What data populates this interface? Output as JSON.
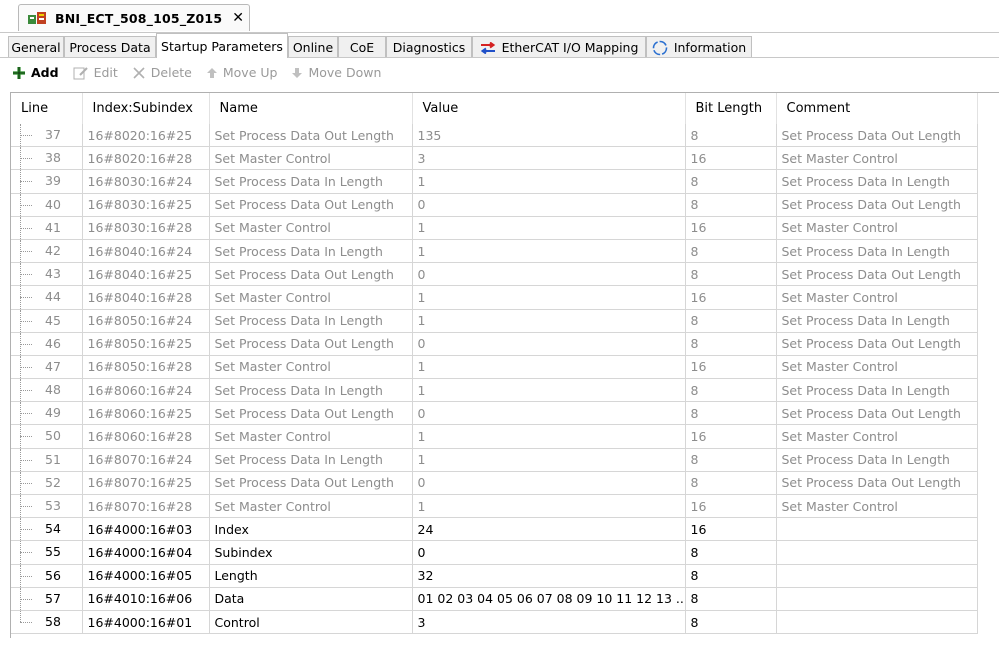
{
  "document": {
    "title": "BNI_ECT_508_105_Z015",
    "close_glyph": "✕"
  },
  "tabs": [
    {
      "label": "General",
      "active": false
    },
    {
      "label": "Process Data",
      "active": false
    },
    {
      "label": "Startup Parameters",
      "active": true
    },
    {
      "label": "Online",
      "active": false
    },
    {
      "label": "CoE",
      "active": false
    },
    {
      "label": "Diagnostics",
      "active": false
    },
    {
      "label": "EtherCAT I/O Mapping",
      "active": false,
      "icon": "io-mapping-icon"
    },
    {
      "label": "Information",
      "active": false,
      "icon": "info-circle-icon"
    }
  ],
  "toolbar": {
    "add": "Add",
    "edit": "Edit",
    "delete": "Delete",
    "move_up": "Move Up",
    "move_down": "Move Down"
  },
  "grid": {
    "columns": [
      "Line",
      "Index:Subindex",
      "Name",
      "Value",
      "Bit Length",
      "Comment"
    ],
    "rows": [
      {
        "line": "37",
        "index": "16#8020:16#25",
        "name": "Set Process Data Out Length",
        "value": "135",
        "bits": "8",
        "comment": "Set Process Data Out Length",
        "grey": true
      },
      {
        "line": "38",
        "index": "16#8020:16#28",
        "name": "Set Master Control",
        "value": "3",
        "bits": "16",
        "comment": "Set Master Control",
        "grey": true
      },
      {
        "line": "39",
        "index": "16#8030:16#24",
        "name": "Set Process Data In Length",
        "value": "1",
        "bits": "8",
        "comment": "Set Process Data In Length",
        "grey": true
      },
      {
        "line": "40",
        "index": "16#8030:16#25",
        "name": "Set Process Data Out Length",
        "value": "0",
        "bits": "8",
        "comment": "Set Process Data Out Length",
        "grey": true
      },
      {
        "line": "41",
        "index": "16#8030:16#28",
        "name": "Set Master Control",
        "value": "1",
        "bits": "16",
        "comment": "Set Master Control",
        "grey": true
      },
      {
        "line": "42",
        "index": "16#8040:16#24",
        "name": "Set Process Data In Length",
        "value": "1",
        "bits": "8",
        "comment": "Set Process Data In Length",
        "grey": true
      },
      {
        "line": "43",
        "index": "16#8040:16#25",
        "name": "Set Process Data Out Length",
        "value": "0",
        "bits": "8",
        "comment": "Set Process Data Out Length",
        "grey": true
      },
      {
        "line": "44",
        "index": "16#8040:16#28",
        "name": "Set Master Control",
        "value": "1",
        "bits": "16",
        "comment": "Set Master Control",
        "grey": true
      },
      {
        "line": "45",
        "index": "16#8050:16#24",
        "name": "Set Process Data In Length",
        "value": "1",
        "bits": "8",
        "comment": "Set Process Data In Length",
        "grey": true
      },
      {
        "line": "46",
        "index": "16#8050:16#25",
        "name": "Set Process Data Out Length",
        "value": "0",
        "bits": "8",
        "comment": "Set Process Data Out Length",
        "grey": true
      },
      {
        "line": "47",
        "index": "16#8050:16#28",
        "name": "Set Master Control",
        "value": "1",
        "bits": "16",
        "comment": "Set Master Control",
        "grey": true
      },
      {
        "line": "48",
        "index": "16#8060:16#24",
        "name": "Set Process Data In Length",
        "value": "1",
        "bits": "8",
        "comment": "Set Process Data In Length",
        "grey": true
      },
      {
        "line": "49",
        "index": "16#8060:16#25",
        "name": "Set Process Data Out Length",
        "value": "0",
        "bits": "8",
        "comment": "Set Process Data Out Length",
        "grey": true
      },
      {
        "line": "50",
        "index": "16#8060:16#28",
        "name": "Set Master Control",
        "value": "1",
        "bits": "16",
        "comment": "Set Master Control",
        "grey": true
      },
      {
        "line": "51",
        "index": "16#8070:16#24",
        "name": "Set Process Data In Length",
        "value": "1",
        "bits": "8",
        "comment": "Set Process Data In Length",
        "grey": true
      },
      {
        "line": "52",
        "index": "16#8070:16#25",
        "name": "Set Process Data Out Length",
        "value": "0",
        "bits": "8",
        "comment": "Set Process Data Out Length",
        "grey": true
      },
      {
        "line": "53",
        "index": "16#8070:16#28",
        "name": "Set Master Control",
        "value": "1",
        "bits": "16",
        "comment": "Set Master Control",
        "grey": true
      },
      {
        "line": "54",
        "index": "16#4000:16#03",
        "name": "Index",
        "value": "24",
        "bits": "16",
        "comment": "",
        "grey": false
      },
      {
        "line": "55",
        "index": "16#4000:16#04",
        "name": "Subindex",
        "value": "0",
        "bits": "8",
        "comment": "",
        "grey": false
      },
      {
        "line": "56",
        "index": "16#4000:16#05",
        "name": "Length",
        "value": "32",
        "bits": "8",
        "comment": "",
        "grey": false
      },
      {
        "line": "57",
        "index": "16#4010:16#06",
        "name": "Data",
        "value": "01 02 03 04 05 06 07 08 09 10 11 12 13 ...",
        "bits": "8",
        "comment": "",
        "grey": false
      },
      {
        "line": "58",
        "index": "16#4000:16#01",
        "name": "Control",
        "value": "3",
        "bits": "8",
        "comment": "",
        "grey": false
      }
    ]
  },
  "colors": {
    "disabled_text": "#9a9a9a",
    "inactive_row_text": "#8d8d8d",
    "add_icon": "#2c8a2c",
    "io_mapping_red": "#d42020",
    "io_mapping_blue": "#2050c8",
    "info_icon": "#2a6fd0"
  }
}
